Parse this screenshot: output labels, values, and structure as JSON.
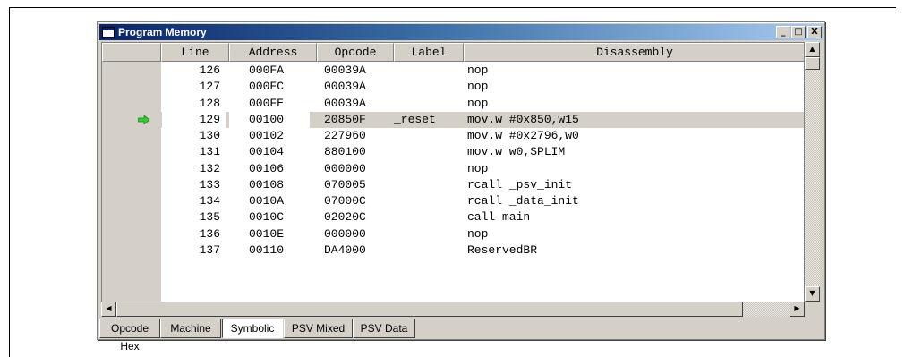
{
  "window": {
    "title": "Program Memory",
    "minimize": "_",
    "maximize": "□",
    "close": "X"
  },
  "columns": {
    "line": "Line",
    "address": "Address",
    "opcode": "Opcode",
    "label": "Label",
    "disassembly": "Disassembly"
  },
  "rows": [
    {
      "line": "126",
      "address": "000FA",
      "opcode": "00039A",
      "label": "",
      "disassembly": "nop"
    },
    {
      "line": "127",
      "address": "000FC",
      "opcode": "00039A",
      "label": "",
      "disassembly": "nop"
    },
    {
      "line": "128",
      "address": "000FE",
      "opcode": "00039A",
      "label": "",
      "disassembly": "nop"
    },
    {
      "line": "129",
      "address": "00100",
      "opcode": "20850F",
      "label": "_reset",
      "disassembly": "mov.w #0x850,w15",
      "current": true
    },
    {
      "line": "130",
      "address": "00102",
      "opcode": "227960",
      "label": "",
      "disassembly": "mov.w #0x2796,w0"
    },
    {
      "line": "131",
      "address": "00104",
      "opcode": "880100",
      "label": "",
      "disassembly": "mov.w w0,SPLIM"
    },
    {
      "line": "132",
      "address": "00106",
      "opcode": "000000",
      "label": "",
      "disassembly": "nop"
    },
    {
      "line": "133",
      "address": "00108",
      "opcode": "070005",
      "label": "",
      "disassembly": "rcall _psv_init"
    },
    {
      "line": "134",
      "address": "0010A",
      "opcode": "07000C",
      "label": "",
      "disassembly": "rcall _data_init"
    },
    {
      "line": "135",
      "address": "0010C",
      "opcode": "02020C",
      "label": "",
      "disassembly": "call main"
    },
    {
      "line": "136",
      "address": "0010E",
      "opcode": "000000",
      "label": "",
      "disassembly": "nop"
    },
    {
      "line": "137",
      "address": "00110",
      "opcode": "DA4000",
      "label": "",
      "disassembly": "ReservedBR"
    }
  ],
  "current_marker_icon": "green-arrow-icon",
  "tabs": [
    {
      "label": "Opcode Hex",
      "active": false
    },
    {
      "label": "Machine",
      "active": false
    },
    {
      "label": "Symbolic",
      "active": true
    },
    {
      "label": "PSV Mixed",
      "active": false
    },
    {
      "label": "PSV Data",
      "active": false
    }
  ],
  "colors": {
    "title_bar": "#0a246a",
    "current_arrow": "#33cc33",
    "current_row": "#d4d0c8"
  }
}
